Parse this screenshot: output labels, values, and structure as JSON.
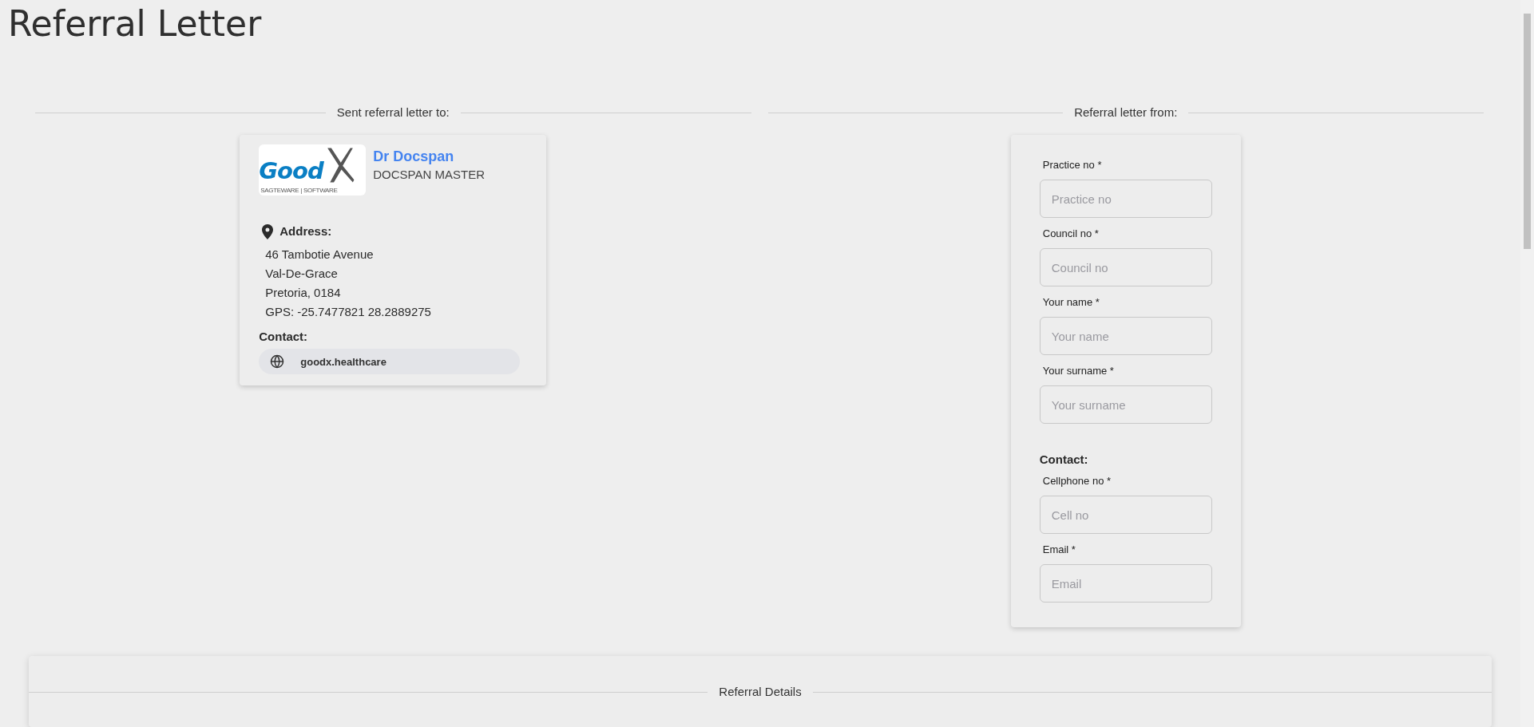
{
  "page": {
    "title": "Referral Letter"
  },
  "recipient": {
    "heading": "Sent referral letter to:",
    "logo": {
      "wordmark": "Good",
      "tagline": "SAGTEWARE | SOFTWARE"
    },
    "name": "Dr Docspan",
    "subtitle": "DOCSPAN MASTER",
    "address_label": "Address:",
    "address_lines": [
      "46 Tambotie Avenue",
      "Val-De-Grace",
      "Pretoria, 0184",
      "GPS: -25.7477821 28.2889275"
    ],
    "contact_label": "Contact:",
    "contacts": [
      {
        "kind": "website",
        "text": "goodx.healthcare"
      }
    ]
  },
  "sender": {
    "heading": "Referral letter from:",
    "fields": [
      {
        "label": "Practice no *",
        "placeholder": "Practice no"
      },
      {
        "label": "Council no *",
        "placeholder": "Council no"
      },
      {
        "label": "Your name *",
        "placeholder": "Your name"
      },
      {
        "label": "Your surname *",
        "placeholder": "Your surname"
      }
    ],
    "contact_label": "Contact:",
    "contact_fields": [
      {
        "label": "Cellphone no *",
        "placeholder": "Cell no"
      },
      {
        "label": "Email *",
        "placeholder": "Email"
      }
    ]
  },
  "details": {
    "heading": "Referral Details"
  }
}
